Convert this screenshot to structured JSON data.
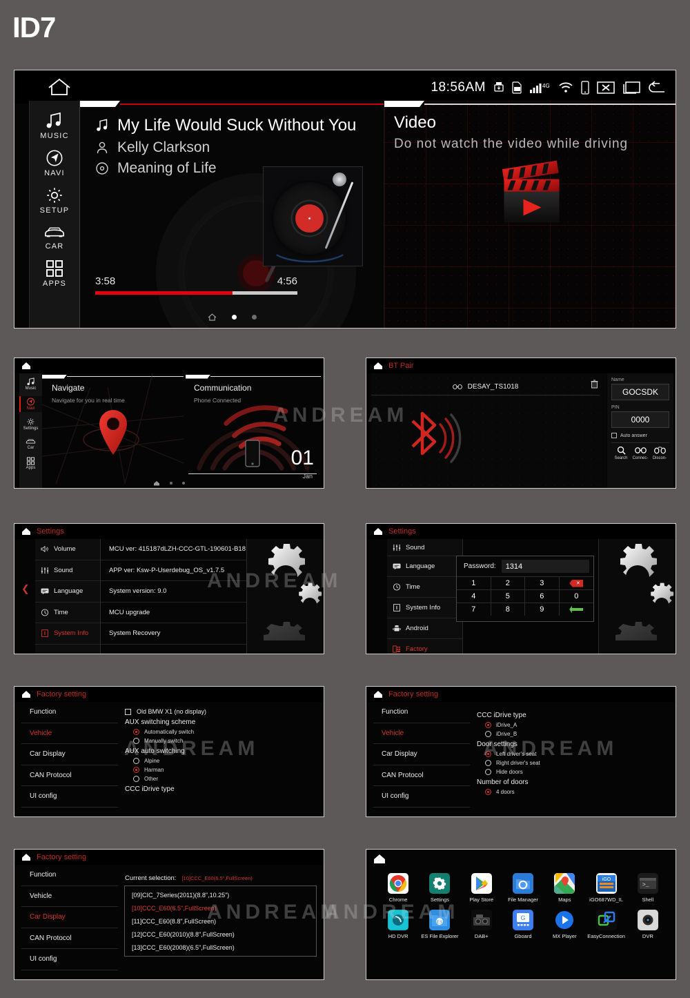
{
  "page_title": "ID7",
  "watermark": "ANDREAM",
  "hero": {
    "home_icon": "home-icon",
    "status": {
      "time": "18:56AM",
      "icons": [
        "usb-icon",
        "sd-card-icon",
        "signal-bars-icon",
        "4g-label",
        "wifi-icon",
        "phone-icon",
        "close-x-icon",
        "multitask-icon",
        "back-arrow-icon"
      ],
      "network_label": "4G"
    },
    "sidebar": [
      {
        "label": "MUSIC",
        "icon": "music-note-icon"
      },
      {
        "label": "NAVI",
        "icon": "navigation-compass-icon"
      },
      {
        "label": "SETUP",
        "icon": "gear-icon"
      },
      {
        "label": "CAR",
        "icon": "car-icon"
      },
      {
        "label": "APPS",
        "icon": "grid-apps-icon"
      }
    ],
    "music": {
      "title": "My Life Would Suck Without You",
      "artist": "Kelly Clarkson",
      "album": "Meaning of Life",
      "elapsed": "3:58",
      "total": "4:56",
      "progress_percent": 68,
      "accent": "#e60012"
    },
    "video": {
      "title": "Video",
      "warning": "Do not watch the video while driving",
      "icon": "clapperboard-play-icon"
    }
  },
  "nav_panel": {
    "sidebar": [
      {
        "label": "Music",
        "icon": "music-note-icon"
      },
      {
        "label": "Navi",
        "icon": "navigation-compass-icon"
      },
      {
        "label": "Settings",
        "icon": "gear-icon"
      },
      {
        "label": "Car",
        "icon": "car-icon"
      },
      {
        "label": "Apps",
        "icon": "grid-apps-icon"
      }
    ],
    "active": "Navi",
    "navigate": {
      "title": "Navigate",
      "subtitle": "Navigate for you in real time"
    },
    "communication": {
      "title": "Communication",
      "subtitle": "Phone Connected",
      "day": "01",
      "month": "Jan"
    }
  },
  "bt_panel": {
    "header": "BT Pair",
    "device": "DESAY_TS1018",
    "device_icon": "link-icon",
    "delete_icon": "trash-icon",
    "name_label": "Name",
    "name_value": "GOCSDK",
    "pin_label": "PIN",
    "pin_value": "0000",
    "auto_answer": "Auto answer",
    "buttons": [
      {
        "label": "Search",
        "icon": "search-icon"
      },
      {
        "label": "Connec-",
        "icon": "link-icon"
      },
      {
        "label": "Discon-",
        "icon": "unlink-icon"
      }
    ]
  },
  "settings_panel": {
    "header": "Settings",
    "menu": [
      {
        "label": "Volume",
        "icon": "speaker-icon",
        "selected": false
      },
      {
        "label": "Sound",
        "icon": "equalizer-icon",
        "selected": false
      },
      {
        "label": "Language",
        "icon": "keyboard-icon",
        "selected": false
      },
      {
        "label": "Time",
        "icon": "clock-icon",
        "selected": false
      },
      {
        "label": "System Info",
        "icon": "info-icon",
        "selected": true
      }
    ],
    "items": [
      "MCU ver: 415187dLZH-CCC-GTL-190601-B18",
      "APP ver: Ksw-P-Userdebug_OS_v1.7.5",
      "System version: 9.0",
      "MCU upgrade",
      "System Recovery"
    ],
    "back_chevron": "chevron-left-icon",
    "gear_icon": "gears-icon"
  },
  "password_panel": {
    "header": "Settings",
    "menu": [
      {
        "label": "Sound",
        "icon": "equalizer-icon",
        "selected": false
      },
      {
        "label": "Language",
        "icon": "keyboard-icon",
        "selected": false
      },
      {
        "label": "Time",
        "icon": "clock-icon",
        "selected": false
      },
      {
        "label": "System Info",
        "icon": "info-icon",
        "selected": false
      },
      {
        "label": "Android",
        "icon": "android-icon",
        "selected": false
      },
      {
        "label": "Factory",
        "icon": "factory-icon",
        "selected": true
      }
    ],
    "password_label": "Password:",
    "password_value": "1314",
    "keys": [
      "1",
      "2",
      "3",
      "del",
      "4",
      "5",
      "6",
      "0",
      "7",
      "8",
      "9",
      "ok"
    ],
    "delete_icon": "backspace-icon",
    "enter_icon": "enter-arrow-icon"
  },
  "factory_vehicle": {
    "header": "Factory setting",
    "menu": [
      {
        "label": "Function",
        "selected": false
      },
      {
        "label": "Vehicle",
        "selected": true
      },
      {
        "label": "Car Display",
        "selected": false
      },
      {
        "label": "CAN Protocol",
        "selected": false
      },
      {
        "label": "UI config",
        "selected": false
      }
    ],
    "checkbox": {
      "label": "Old BMW X1 (no display)",
      "checked": false
    },
    "groups": [
      {
        "title": "AUX switching scheme",
        "options": [
          {
            "label": "Automatically switch",
            "selected": true
          },
          {
            "label": "Manually switch",
            "selected": false
          }
        ]
      },
      {
        "title": "AUX auto switching",
        "options": [
          {
            "label": "Alpine",
            "selected": false
          },
          {
            "label": "Harman",
            "selected": true
          },
          {
            "label": "Other",
            "selected": false
          }
        ]
      }
    ],
    "trailing_title": "CCC iDrive type"
  },
  "factory_idrive": {
    "header": "Factory setting",
    "menu": [
      {
        "label": "Function",
        "selected": false
      },
      {
        "label": "Vehicle",
        "selected": true
      },
      {
        "label": "Car Display",
        "selected": false
      },
      {
        "label": "CAN Protocol",
        "selected": false
      },
      {
        "label": "UI config",
        "selected": false
      }
    ],
    "groups": [
      {
        "title": "CCC iDrive type",
        "options": [
          {
            "label": "iDrive_A",
            "selected": true
          },
          {
            "label": "iDrive_B",
            "selected": false
          }
        ]
      },
      {
        "title": "Door settings",
        "options": [
          {
            "label": "Left driver's seat",
            "selected": true
          },
          {
            "label": "Right driver's seat",
            "selected": false
          },
          {
            "label": "Hide doors",
            "selected": false
          }
        ]
      },
      {
        "title": "Number of doors",
        "options": [
          {
            "label": "4 doors",
            "selected": true
          }
        ]
      }
    ]
  },
  "factory_cardisplay": {
    "header": "Factory setting",
    "menu": [
      {
        "label": "Function",
        "selected": false
      },
      {
        "label": "Vehicle",
        "selected": false
      },
      {
        "label": "Car Display",
        "selected": true
      },
      {
        "label": "CAN Protocol",
        "selected": false
      },
      {
        "label": "UI config",
        "selected": false
      }
    ],
    "current_label": "Current selection:",
    "current_value": "[10]CCC_E60(6.5\",FullScreen)",
    "options": [
      {
        "label": "[09]CIC_7Series(2011)(8.8\",10.25\")",
        "selected": false
      },
      {
        "label": "[10]CCC_E60(6.5\",FullScreen)",
        "selected": true
      },
      {
        "label": "[11]CCC_E60(8.8\",FullScreen)",
        "selected": false
      },
      {
        "label": "[12]CCC_E60(2010)(8.8\",FullScreen)",
        "selected": false
      },
      {
        "label": "[13]CCC_E60(2008)(6.5\",FullScreen)",
        "selected": false
      }
    ]
  },
  "apps_panel": {
    "home_icon": "home-icon",
    "apps": [
      {
        "name": "Chrome",
        "icon": "chrome-icon"
      },
      {
        "name": "Settings",
        "icon": "settings-gear-icon"
      },
      {
        "name": "Play Store",
        "icon": "play-store-icon"
      },
      {
        "name": "File Manager",
        "icon": "file-manager-icon"
      },
      {
        "name": "Maps",
        "icon": "maps-icon"
      },
      {
        "name": "iGO687WD_IL",
        "icon": "igo-navigation-icon"
      },
      {
        "name": "Shell",
        "icon": "shell-terminal-icon"
      },
      {
        "name": "HD DVR",
        "icon": "hd-dvr-icon"
      },
      {
        "name": "ES File Explorer",
        "icon": "es-file-explorer-icon"
      },
      {
        "name": "DAB+",
        "icon": "dab-radio-icon"
      },
      {
        "name": "Gboard",
        "icon": "gboard-icon"
      },
      {
        "name": "MX Player",
        "icon": "mx-player-icon"
      },
      {
        "name": "EasyConnection",
        "icon": "easyconnection-icon"
      },
      {
        "name": "DVR",
        "icon": "dvr-camera-icon"
      }
    ]
  }
}
